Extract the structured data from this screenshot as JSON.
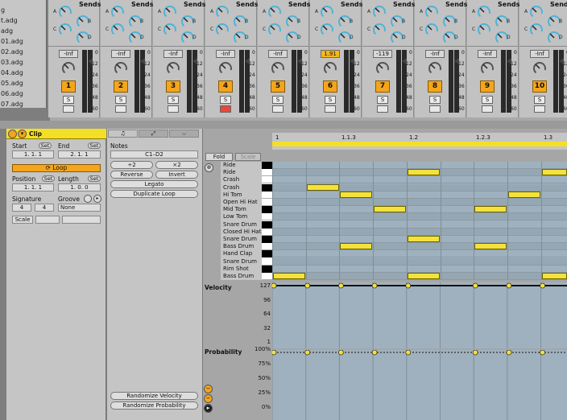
{
  "browser": {
    "items": [
      "g",
      "t.adg",
      "adg",
      "01.adg",
      "02.adg",
      "03.adg",
      "04.adg",
      "05.adg",
      "06.adg",
      "07.adg"
    ]
  },
  "mixer": {
    "sends_label": "Sends",
    "knob_labels": [
      "A",
      "B",
      "C",
      "D"
    ],
    "meter_scale": [
      "0",
      "12",
      "24",
      "36",
      "48",
      "60"
    ],
    "solo_label": "S",
    "tracks": [
      {
        "number": "1",
        "volume": "-Inf",
        "armed": false
      },
      {
        "number": "2",
        "volume": "-Inf",
        "armed": false
      },
      {
        "number": "3",
        "volume": "-Inf",
        "armed": false
      },
      {
        "number": "4",
        "volume": "-Inf",
        "armed": true
      },
      {
        "number": "5",
        "volume": "-Inf",
        "armed": false
      },
      {
        "number": "6",
        "volume": "1.91",
        "armed": false
      },
      {
        "number": "7",
        "volume": "-119",
        "armed": false
      },
      {
        "number": "8",
        "volume": "-Inf",
        "armed": false
      },
      {
        "number": "9",
        "volume": "-Inf",
        "armed": false
      },
      {
        "number": "10",
        "volume": "-Inf",
        "armed": false
      }
    ]
  },
  "clip": {
    "title": "Clip",
    "start_label": "Start",
    "end_label": "End",
    "set_label": "Set",
    "start_value": "1.   1.   1",
    "end_value": "2.   1.   1",
    "loop_label": "Loop",
    "position_label": "Position",
    "length_label": "Length",
    "position_value": "1.   1.   1",
    "length_value": "1.   0.   0",
    "signature_label": "Signature",
    "groove_label": "Groove",
    "sig_num": "4",
    "sig_den": "4",
    "groove_value": "None",
    "scale_label": "Scale"
  },
  "notes": {
    "title": "Notes",
    "range": "C1–D2",
    "half": "÷2",
    "double": "×2",
    "reverse": "Reverse",
    "invert": "Invert",
    "legato": "Legato",
    "duplicate": "Duplicate Loop",
    "rand_vel": "Randomize Velocity",
    "rand_prob": "Randomize Probability"
  },
  "editor": {
    "fold_label": "Fold",
    "scale_label": "Scale",
    "ruler": [
      "1",
      "1.1.3",
      "1.2",
      "1.2.3",
      "1.3"
    ],
    "lanes": [
      "Ride",
      "Ride",
      "Crash",
      "Crash",
      "Hi Tom",
      "Open Hi Hat",
      "Mid Tom",
      "Low Tom",
      "Snare Drum",
      "Closed Hi Hat",
      "Snare Drum",
      "Bass Drum",
      "Hand Clap",
      "Snare Drum",
      "Rim Shot",
      "Bass Drum"
    ],
    "velocity_label": "Velocity",
    "velocity_axis": [
      "127",
      "96",
      "64",
      "32",
      "1"
    ],
    "probability_label": "Probability",
    "probability_axis": [
      "100%",
      "75%",
      "50%",
      "25%",
      "0%"
    ]
  }
}
